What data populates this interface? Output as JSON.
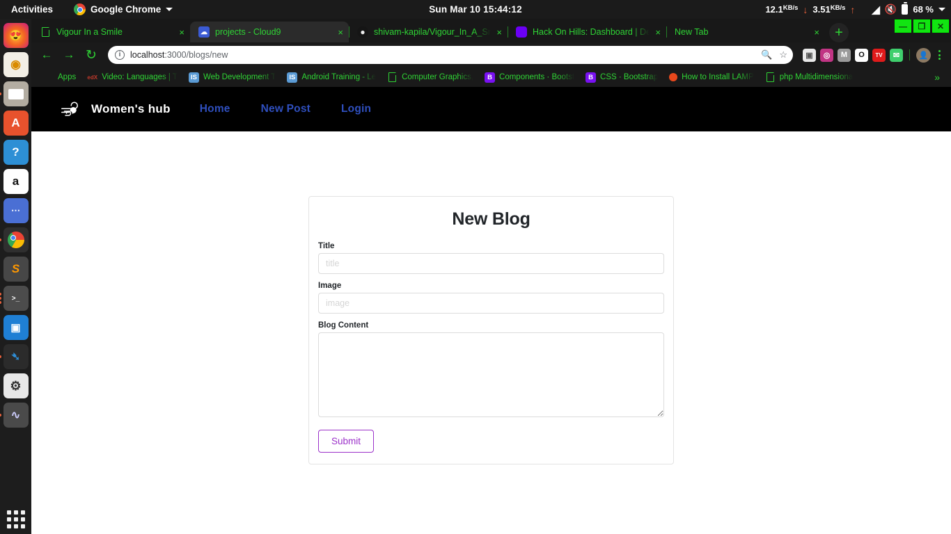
{
  "os_bar": {
    "activities": "Activities",
    "app_name": "Google Chrome",
    "app_icon": "chrome-icon",
    "clock": "Sun Mar 10  15:44:12",
    "network_down": "12.1",
    "network_down_unit": "KB/s",
    "network_up": "3.51",
    "network_up_unit": "KB/s",
    "battery": "68 %",
    "icons": [
      "wifi-icon",
      "volume-muted-icon",
      "battery-icon",
      "chevron-down-icon"
    ]
  },
  "dock": {
    "items": [
      {
        "name": "firefox",
        "label": "Firefox",
        "color": "#1a1a1a",
        "glyph": "🦊",
        "running": false
      },
      {
        "name": "rhythmbox",
        "label": "Rhythmbox",
        "color": "#f0ece0",
        "glyph": "◉",
        "running": false
      },
      {
        "name": "files",
        "label": "Files",
        "color": "#b8b2a8",
        "glyph": "▭",
        "running": true
      },
      {
        "name": "software-center",
        "label": "Ubuntu Software",
        "color": "#e8522d",
        "glyph": "A",
        "running": false
      },
      {
        "name": "help",
        "label": "Help",
        "color": "#2d8fd5",
        "glyph": "?",
        "running": false
      },
      {
        "name": "amazon",
        "label": "Amazon",
        "color": "#ffffff",
        "glyph": "a",
        "running": false
      },
      {
        "name": "show-applications-grid",
        "label": "App Grid",
        "color": "#4a6fd4",
        "glyph": "⋯",
        "running": false
      },
      {
        "name": "google-chrome",
        "label": "Google Chrome",
        "color": "#2b2b2b",
        "glyph": "●",
        "running": true
      },
      {
        "name": "sublime-text",
        "label": "Sublime Text",
        "color": "#464646",
        "glyph": "S",
        "running": false
      },
      {
        "name": "terminal",
        "label": "Terminal",
        "color": "#4a4a4a",
        "glyph": ">_",
        "running": true
      },
      {
        "name": "vmware",
        "label": "VMware",
        "color": "#1f7fd4",
        "glyph": "▣",
        "running": false
      },
      {
        "name": "vscode",
        "label": "Visual Studio Code",
        "color": "#2b2b2b",
        "glyph": "✕",
        "running": true
      },
      {
        "name": "settings",
        "label": "Settings",
        "color": "#e8e8e8",
        "glyph": "⚙",
        "running": false
      },
      {
        "name": "system-monitor",
        "label": "System Monitor",
        "color": "#4a4a4a",
        "glyph": "∿",
        "running": true
      }
    ]
  },
  "browser": {
    "tabs": [
      {
        "title": "Vigour In a Smile",
        "favicon": "document-icon",
        "favicon_color": "#2fd435",
        "active": false,
        "close": "×"
      },
      {
        "title": "projects - Cloud9",
        "favicon": "cloud9-icon",
        "favicon_color": "#3b5bd4",
        "active": true,
        "close": "×"
      },
      {
        "title": "shivam-kapila/Vigour_In_A_Smile",
        "favicon": "github-icon",
        "favicon_color": "#24292e",
        "active": false,
        "close": "×"
      },
      {
        "title": "Hack On Hills: Dashboard | Dev",
        "favicon": "hackonhills-icon",
        "favicon_color": "#6b00f5",
        "active": false,
        "close": "×"
      },
      {
        "title": "New Tab",
        "favicon": "none",
        "favicon_color": "#181818",
        "active": false,
        "close": "×"
      }
    ],
    "new_tab_button": "+",
    "window_controls": {
      "minimize": "—",
      "maximize": "❐",
      "close": "✕"
    },
    "toolbar": {
      "back": "←",
      "forward": "→",
      "reload": "↻",
      "url_host": "localhost",
      "url_path": ":3000/blogs/new",
      "site_info_icon": "info-icon",
      "search_icon": "search-icon",
      "bookmark_icon": "star-icon",
      "menu_icon": "kebab-menu-icon"
    },
    "extensions": [
      {
        "name": "box-extension",
        "glyph": "⬜",
        "color": "#e9e9e9",
        "fg": "#555"
      },
      {
        "name": "instagram-extension",
        "glyph": "◎",
        "color": "#d6356b",
        "fg": "#fff"
      },
      {
        "name": "momentum-extension",
        "glyph": "M",
        "color": "#9a9a9a",
        "fg": "#fff"
      },
      {
        "name": "opera-extension",
        "glyph": "O",
        "color": "#ffffff",
        "fg": "#111"
      },
      {
        "name": "tv-extension",
        "glyph": "TV",
        "color": "#e01b1b",
        "fg": "#fff"
      },
      {
        "name": "mail-extension",
        "glyph": "✉",
        "color": "#3fcf6d",
        "fg": "#fff"
      },
      {
        "name": "profile-avatar",
        "glyph": "●",
        "color": "#8d7a63",
        "fg": "#fff"
      }
    ],
    "bookmarks": [
      {
        "label": "Apps",
        "icon": "apps-grid-icon",
        "icon_color": "#f0f0f0",
        "icon_fg": "#4285f4"
      },
      {
        "label": "Video: Languages | T",
        "icon": "edx-icon",
        "icon_color": "#1a1a1a",
        "icon_fg": "#c0392b"
      },
      {
        "label": "Web Development T",
        "icon": "is-icon",
        "icon_color": "#5b9bd5",
        "icon_fg": "#ffffff"
      },
      {
        "label": "Android Training - Le",
        "icon": "is-icon",
        "icon_color": "#5b9bd5",
        "icon_fg": "#ffffff"
      },
      {
        "label": "Computer Graphics,",
        "icon": "document-icon",
        "icon_color": "transparent",
        "icon_fg": "#2fd435"
      },
      {
        "label": "Components · Bootst",
        "icon": "bootstrap-icon",
        "icon_color": "#7910f2",
        "icon_fg": "#ffffff"
      },
      {
        "label": "CSS · Bootstrap",
        "icon": "bootstrap-icon",
        "icon_color": "#7910f2",
        "icon_fg": "#ffffff"
      },
      {
        "label": "How to Install LAMP",
        "icon": "circle-icon",
        "icon_color": "#e8481c",
        "icon_fg": "#e8481c"
      },
      {
        "label": "php Multidimensiona",
        "icon": "document-icon",
        "icon_color": "transparent",
        "icon_fg": "#2fd435"
      }
    ],
    "bookmarks_overflow": "»"
  },
  "webpage": {
    "navbar": {
      "logo_icon": "wind-icon",
      "brand": "Women's hub",
      "links": [
        {
          "label": "Home",
          "name": "nav-link-home"
        },
        {
          "label": "New Post",
          "name": "nav-link-new-post"
        },
        {
          "label": "Login",
          "name": "nav-link-login"
        }
      ],
      "bg_color": "#000000",
      "link_color": "#2f4fbe"
    },
    "form": {
      "heading": "New Blog",
      "fields": [
        {
          "label": "Title",
          "placeholder": "title",
          "value": "",
          "type": "text",
          "name": "title"
        },
        {
          "label": "Image",
          "placeholder": "image",
          "value": "",
          "type": "text",
          "name": "image"
        }
      ],
      "textarea": {
        "label": "Blog Content",
        "placeholder": "",
        "value": "",
        "name": "blog-content"
      },
      "submit_label": "Submit",
      "submit_color": "#9b30c9"
    }
  }
}
